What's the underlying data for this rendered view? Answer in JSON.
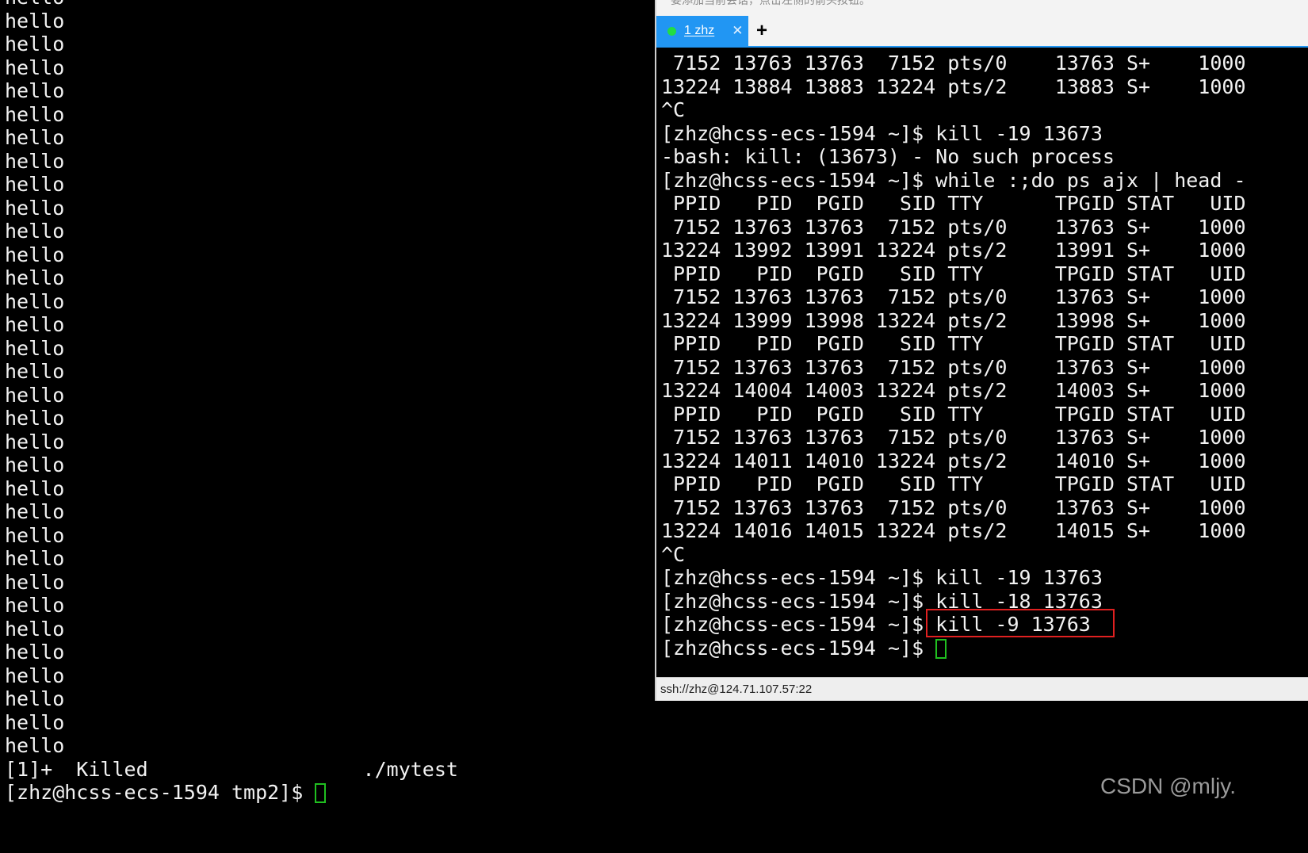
{
  "left_terminal": {
    "lines": [
      "hello",
      "hello",
      "hello",
      "hello",
      "hello",
      "hello",
      "hello",
      "hello",
      "hello",
      "hello",
      "hello",
      "hello",
      "hello",
      "hello",
      "hello",
      "hello",
      "hello",
      "hello",
      "hello",
      "hello",
      "hello",
      "hello",
      "hello",
      "hello",
      "hello",
      "hello",
      "hello",
      "hello",
      "hello",
      "hello",
      "hello",
      "hello",
      "hello",
      "[1]+  Killed                  ./mytest"
    ],
    "prompt": "[zhz@hcss-ecs-1594 tmp2]$ "
  },
  "ssh_window": {
    "top_strip_text": "要添加当前会话，点击左侧的箭头按钮。",
    "tab": {
      "label": "1 zhz",
      "close": "✕"
    },
    "add_tab": "+",
    "lines": [
      " 7152 13763 13763  7152 pts/0    13763 S+    1000",
      "13224 13884 13883 13224 pts/2    13883 S+    1000",
      "^C",
      "[zhz@hcss-ecs-1594 ~]$ kill -19 13673",
      "-bash: kill: (13673) - No such process",
      "[zhz@hcss-ecs-1594 ~]$ while :;do ps ajx | head -",
      " PPID   PID  PGID   SID TTY      TPGID STAT   UID",
      " 7152 13763 13763  7152 pts/0    13763 S+    1000",
      "13224 13992 13991 13224 pts/2    13991 S+    1000",
      " PPID   PID  PGID   SID TTY      TPGID STAT   UID",
      " 7152 13763 13763  7152 pts/0    13763 S+    1000",
      "13224 13999 13998 13224 pts/2    13998 S+    1000",
      " PPID   PID  PGID   SID TTY      TPGID STAT   UID",
      " 7152 13763 13763  7152 pts/0    13763 S+    1000",
      "13224 14004 14003 13224 pts/2    14003 S+    1000",
      " PPID   PID  PGID   SID TTY      TPGID STAT   UID",
      " 7152 13763 13763  7152 pts/0    13763 S+    1000",
      "13224 14011 14010 13224 pts/2    14010 S+    1000",
      " PPID   PID  PGID   SID TTY      TPGID STAT   UID",
      " 7152 13763 13763  7152 pts/0    13763 S+    1000",
      "13224 14016 14015 13224 pts/2    14015 S+    1000",
      "^C",
      "[zhz@hcss-ecs-1594 ~]$ kill -19 13763",
      "[zhz@hcss-ecs-1594 ~]$ kill -18 13763",
      "[zhz@hcss-ecs-1594 ~]$ kill -9 13763"
    ],
    "prompt": "[zhz@hcss-ecs-1594 ~]$ ",
    "status_text": "ssh://zhz@124.71.107.57:22",
    "highlight_color": "#e02020",
    "tab_color": "#2196f3",
    "cursor_color": "#20c020"
  },
  "watermark": "CSDN @mljy."
}
